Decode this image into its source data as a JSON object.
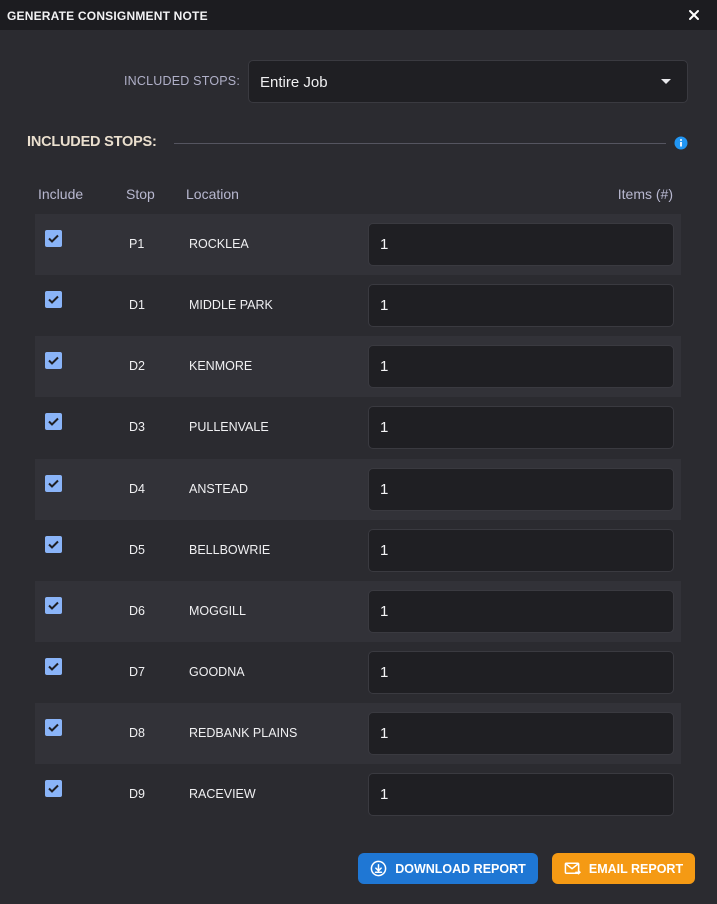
{
  "dialog": {
    "title": "GENERATE CONSIGNMENT NOTE"
  },
  "filter": {
    "label": "INCLUDED STOPS:",
    "selected": "Entire Job"
  },
  "section": {
    "title": "INCLUDED STOPS:"
  },
  "table": {
    "headers": {
      "include": "Include",
      "stop": "Stop",
      "location": "Location",
      "items": "Items (#)"
    },
    "rows": [
      {
        "included": true,
        "stop": "P1",
        "location": "ROCKLEA",
        "items": "1"
      },
      {
        "included": true,
        "stop": "D1",
        "location": "MIDDLE PARK",
        "items": "1"
      },
      {
        "included": true,
        "stop": "D2",
        "location": "KENMORE",
        "items": "1"
      },
      {
        "included": true,
        "stop": "D3",
        "location": "PULLENVALE",
        "items": "1"
      },
      {
        "included": true,
        "stop": "D4",
        "location": "ANSTEAD",
        "items": "1"
      },
      {
        "included": true,
        "stop": "D5",
        "location": "BELLBOWRIE",
        "items": "1"
      },
      {
        "included": true,
        "stop": "D6",
        "location": "MOGGILL",
        "items": "1"
      },
      {
        "included": true,
        "stop": "D7",
        "location": "GOODNA",
        "items": "1"
      },
      {
        "included": true,
        "stop": "D8",
        "location": "REDBANK PLAINS",
        "items": "1"
      },
      {
        "included": true,
        "stop": "D9",
        "location": "RACEVIEW",
        "items": "1"
      }
    ]
  },
  "actions": {
    "download_label": "DOWNLOAD REPORT",
    "email_label": "EMAIL REPORT"
  },
  "colors": {
    "background": "#2b2b30",
    "titlebar": "#1c1c20",
    "checkbox": "#8ab4f8",
    "info": "#2196f3",
    "download_button": "#1f77d4",
    "email_button": "#f59a14"
  },
  "icons": {
    "close": "close-icon",
    "dropdown": "chevron-down-icon",
    "info": "info-icon",
    "checkbox": "checkbox-checked-icon",
    "download": "download-icon",
    "email": "email-icon"
  }
}
